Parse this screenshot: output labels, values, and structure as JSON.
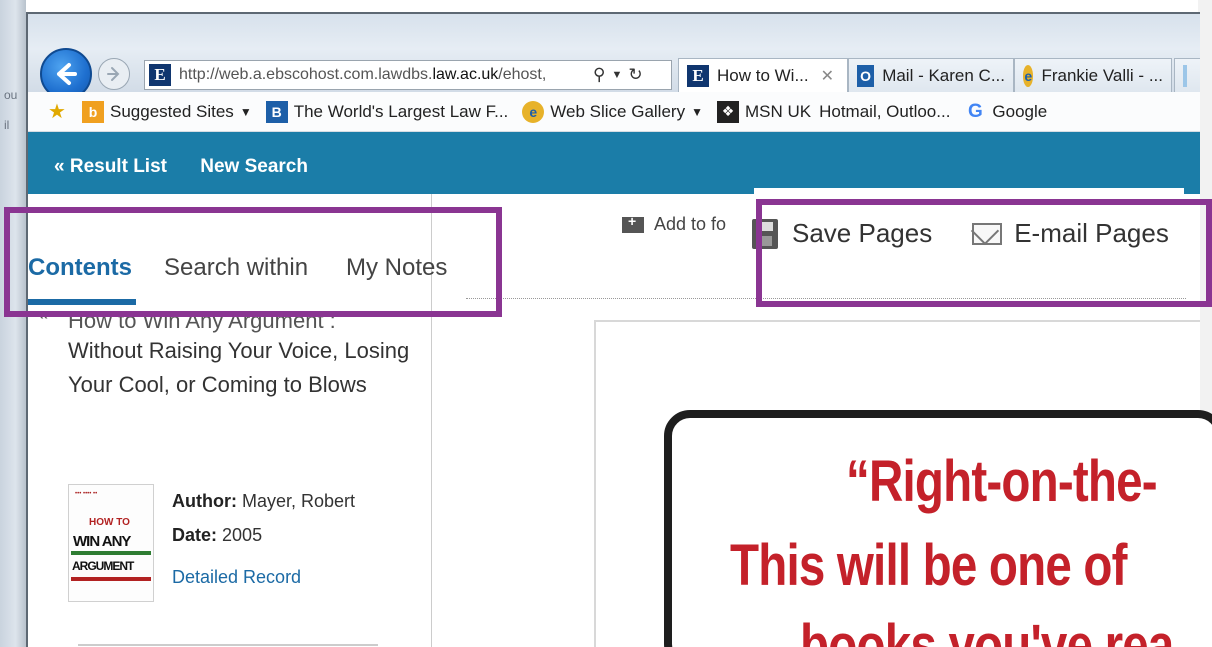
{
  "browser": {
    "address_url_prefix": "http://web.a.ebscohost.com.lawdbs.",
    "address_url_bold": "law.ac.uk",
    "address_url_suffix": "/ehost,",
    "tabs": [
      {
        "label": "How to Wi...",
        "icon": "ebsco-e-icon"
      },
      {
        "label": "Mail - Karen C...",
        "icon": "outlook-icon"
      },
      {
        "label": "Frankie Valli - ...",
        "icon": "ie-icon"
      }
    ],
    "favorites": [
      {
        "label": "Suggested Sites",
        "icon": "bing-icon",
        "dropdown": true
      },
      {
        "label": "The World's Largest Law F...",
        "icon": "law-b-icon",
        "dropdown": false
      },
      {
        "label": "Web Slice Gallery",
        "icon": "ie-icon",
        "dropdown": true
      },
      {
        "label": "MSN UK",
        "icon": "msn-icon",
        "dropdown": false
      },
      {
        "label": "Hotmail, Outloo...",
        "icon": "",
        "dropdown": false
      },
      {
        "label": "Google",
        "icon": "google-icon",
        "dropdown": false
      }
    ]
  },
  "ebsco_nav": {
    "result_list": "« Result List",
    "new_search": "New Search"
  },
  "panel_tabs": {
    "contents": "Contents",
    "search_within": "Search within",
    "my_notes": "My Notes"
  },
  "book": {
    "title_cut": "How to Win Any Argument :",
    "title": "Without Raising Your Voice, Losing Your Cool, or Coming to Blows",
    "author_label": "Author:",
    "author": "Mayer, Robert",
    "date_label": "Date:",
    "date": "2005",
    "detailed_record": "Detailed Record",
    "cover": {
      "how_to": "HOW TO",
      "win_any": "WIN ANY",
      "argument": "ARGUMENT"
    }
  },
  "toolbar": {
    "add_to": "Add to fo",
    "save_pages": "Save Pages",
    "email_pages": "E-mail Pages"
  },
  "viewer": {
    "line1": "“Right-on-the-",
    "line2": "This will be one of",
    "line3": "books you've rea"
  },
  "colors": {
    "ebsco_blue": "#1b7da8",
    "highlight_purple": "#8a3592",
    "active_tab": "#1b6aa5",
    "quote_red": "#c4212a"
  }
}
